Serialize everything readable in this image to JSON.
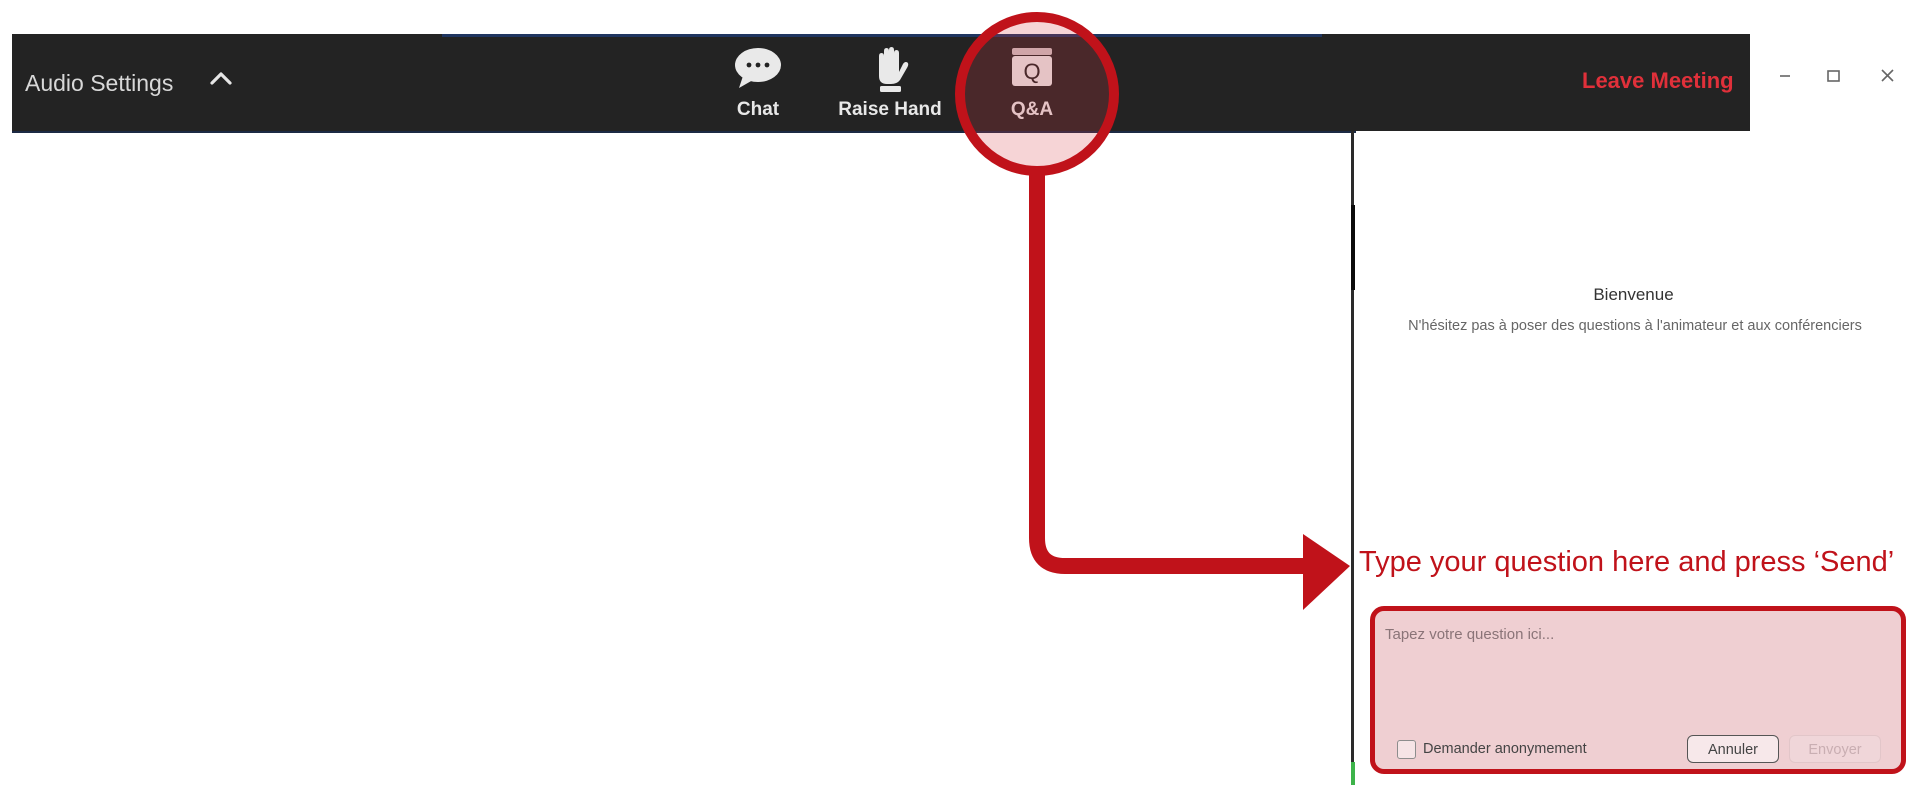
{
  "toolbar": {
    "audio_settings_label": "Audio Settings",
    "buttons": [
      {
        "label": "Chat",
        "icon": "chat-bubble-icon"
      },
      {
        "label": "Raise Hand",
        "icon": "raise-hand-icon"
      },
      {
        "label": "Q&A",
        "icon": "qa-icon"
      }
    ],
    "qa_icon_letter": "Q",
    "leave_label": "Leave Meeting"
  },
  "qa_panel": {
    "welcome_title": "Bienvenue",
    "welcome_subtitle": "N'hésitez pas à poser des questions à l'animateur et aux conférenciers",
    "input_placeholder": "Tapez votre question ici...",
    "anonymous_label": "Demander anonymement",
    "cancel_label": "Annuler",
    "send_label": "Envoyer"
  },
  "annotation": {
    "instruction_text": "Type your question here and press ‘Send’"
  },
  "colors": {
    "toolbar_bg": "#232323",
    "leave_red": "#e0303a",
    "annotation_red": "#c0121a",
    "highlight_fill": "#efcfd2"
  }
}
